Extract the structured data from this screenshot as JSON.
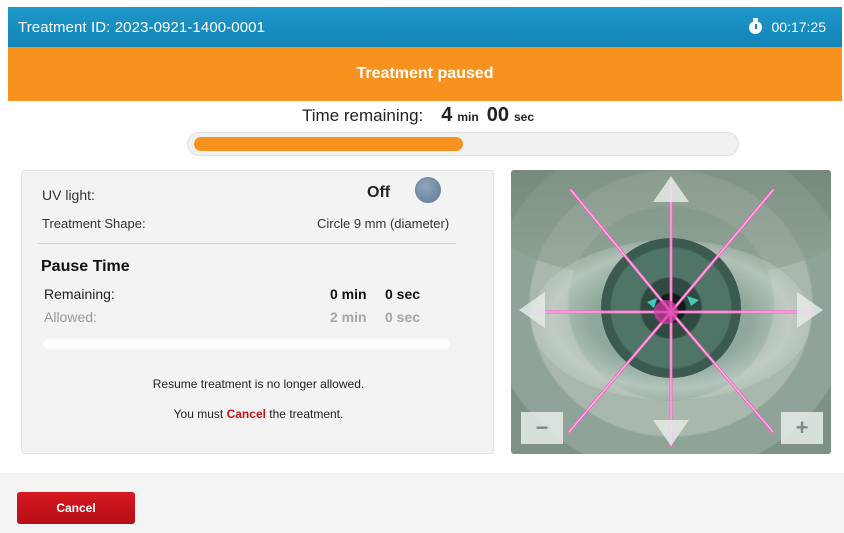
{
  "header": {
    "treatment_id": "Treatment ID: 2023-0921-1400-0001",
    "elapsed_time": "00:17:25",
    "stopwatch_icon": "stopwatch-icon"
  },
  "status": {
    "message": "Treatment paused",
    "color": "#f7921e"
  },
  "time_remaining": {
    "label": "Time remaining:",
    "minutes": "4",
    "min_unit": "min",
    "seconds": "00",
    "sec_unit": "sec",
    "progress_fraction": 0.5
  },
  "info_panel": {
    "uv_label": "UV light:",
    "uv_state": "Off",
    "shape_label": "Treatment Shape:",
    "shape_value": "Circle 9 mm (diameter)",
    "pause_title": "Pause Time",
    "remaining_label": "Remaining:",
    "remaining_min": "0 min",
    "remaining_sec": "0 sec",
    "allowed_label": "Allowed:",
    "allowed_min": "2 min",
    "allowed_sec": "0 sec",
    "pause_progress_fraction": 0.0,
    "message1": "Resume treatment is no longer allowed.",
    "message2_prefix": "You must",
    "message2_cancel": "Cancel",
    "message2_suffix": "the treatment."
  },
  "camera": {
    "zoom_out_label": "−",
    "zoom_in_label": "+",
    "laser_color": "#ff5fc8"
  },
  "footer": {
    "cancel_label": "Cancel",
    "accent_red": "#c0141b"
  }
}
